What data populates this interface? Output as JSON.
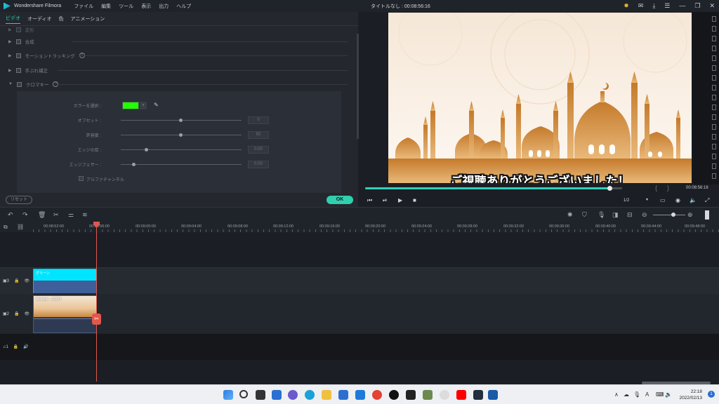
{
  "window": {
    "app_name": "Wondershare Filmora",
    "menu": [
      "ファイル",
      "編集",
      "ツール",
      "表示",
      "出力",
      "ヘルプ"
    ],
    "doc_title": "タイトルなし : 00:08:56:16"
  },
  "editor": {
    "tabs": [
      "ビデオ",
      "オーディオ",
      "色",
      "アニメーション"
    ],
    "active_tab": "ビデオ",
    "sections": [
      {
        "label": "変形",
        "checked": true
      },
      {
        "label": "合成",
        "checked": true
      },
      {
        "label": "モーショントラッキング",
        "checked": false
      },
      {
        "label": "手ぶれ補正",
        "checked": false
      },
      {
        "label": "クロマキー",
        "checked": false
      }
    ],
    "chroma": {
      "color_label": "カラーを選択 :",
      "color_value": "#22ff00",
      "params": [
        {
          "label": "オフセット :",
          "value": "0",
          "level": 0.5
        },
        {
          "label": "許容度 :",
          "value": "50",
          "level": 0.5
        },
        {
          "label": "エッジの厚 :",
          "value": "0.00",
          "level": 0.15
        },
        {
          "label": "エッジフェザー :",
          "value": "0.00",
          "level": 0.15
        }
      ],
      "alpha_channel_label": "アルファチャンネル"
    },
    "reset_label": "リセット",
    "ok_label": "OK"
  },
  "preview": {
    "caption": "ご視聴ありがとうございました！",
    "progress": 0.95,
    "timecode": "00:08:56:16",
    "quality": "1/2"
  },
  "timeline": {
    "ruler_labels": [
      "00:08:52:00",
      "00:08:56:00",
      "00:09:00:00",
      "00:09:04:00",
      "00:09:08:00",
      "00:09:12:00",
      "00:09:16:00",
      "00:09:20:00",
      "00:09:24:00",
      "00:09:28:00",
      "00:09:32:00",
      "00:09:36:00",
      "00:09:40:00",
      "00:09:44:00",
      "00:09:48:00"
    ],
    "clips": {
      "title_clip": "グリーン",
      "video_clip": "Mosque - 32263"
    },
    "track_labels": [
      "3",
      "2",
      "1"
    ]
  },
  "taskbar": {
    "time": "22:18",
    "date": "2022/02/13",
    "ime": "A",
    "notification_count": "1"
  },
  "colors": {
    "accent": "#25d1bb",
    "playhead": "#e2574c",
    "title_clip": "#00e5ff",
    "ok_button": "#30cfae"
  }
}
